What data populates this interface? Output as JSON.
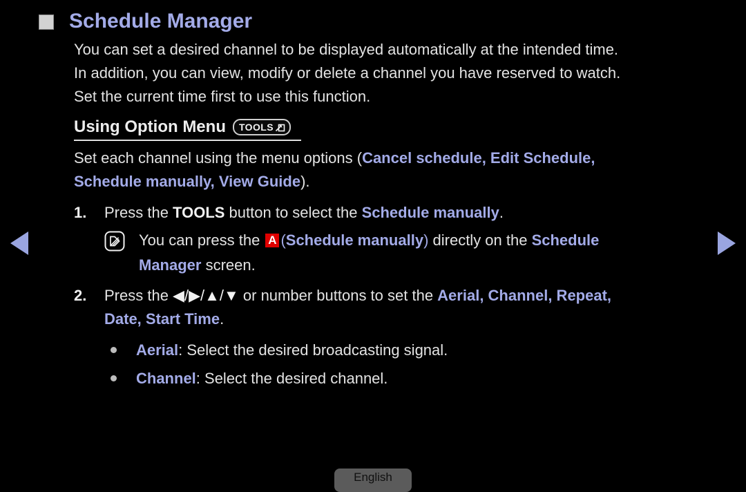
{
  "page": {
    "title": "Schedule Manager",
    "intro_lines": [
      "You can set a desired channel to be displayed automatically at the intended time.",
      "In addition, you can view, modify or delete a channel you have reserved to watch.",
      "Set the current time first to use this function."
    ]
  },
  "section": {
    "heading": "Using Option Menu",
    "badge_label": "TOOLS",
    "badge_icon": "tools-arrow-icon",
    "desc_prefix": "Set each channel using the menu options (",
    "desc_options_line1": "Cancel schedule, Edit Schedule,",
    "desc_options_line2": "Schedule manually, View Guide",
    "desc_suffix": ")."
  },
  "steps": [
    {
      "number": "1.",
      "text_before": "Press the ",
      "bold_key": "TOOLS",
      "text_middle": " button to select the ",
      "highlight": "Schedule manually",
      "text_after": "."
    },
    {
      "number": "2.",
      "text_before": "Press the ",
      "arrow_keys": "◀/▶/▲/▼",
      "text_middle": " or number buttons to set the ",
      "highlight_line1": "Aerial, Channel, Repeat,",
      "highlight_line2": "Date, Start Time",
      "text_after": "."
    }
  ],
  "note": {
    "icon": "note-pen-icon",
    "text_before": "You can press the ",
    "key": "A",
    "key_color": "#e00000",
    "paren_open": "(",
    "highlight_1": "Schedule manually",
    "paren_close": ")",
    "text_middle": " directly on the ",
    "highlight_2": "Schedule",
    "highlight_3": "Manager",
    "text_after": " screen."
  },
  "bullets": [
    {
      "label": "Aerial",
      "text": ": Select the desired broadcasting signal."
    },
    {
      "label": "Channel",
      "text": ": Select the desired channel."
    }
  ],
  "nav": {
    "prev_icon": "arrow-left-icon",
    "next_icon": "arrow-right-icon"
  },
  "footer": {
    "language": "English"
  },
  "colors": {
    "background": "#000000",
    "highlight": "#a3abe8",
    "body_text": "#e3e3e3",
    "key_red": "#e00000",
    "lang_button": "#5b5b5b"
  }
}
